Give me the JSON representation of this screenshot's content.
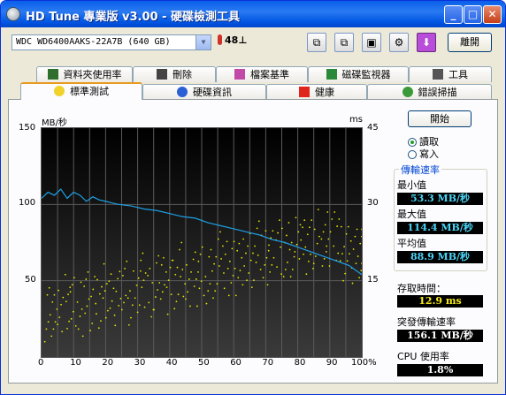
{
  "window": {
    "title": "HD Tune 專業版 v3.00 - 硬碟檢測工具",
    "min": "_",
    "max": "□",
    "close": "✕"
  },
  "toolbar": {
    "drive": "WDC WD6400AAKS-22A7B  (640 GB)",
    "temperature": "48",
    "temperature_unit": "⊥",
    "exit_label": "離開",
    "icons": [
      "copy-text-icon",
      "copy-screen-icon",
      "save-icon",
      "options-icon",
      "download-icon"
    ]
  },
  "tabs_top": [
    {
      "label": "資料夾使用率",
      "icon": "folder-usage-icon"
    },
    {
      "label": "刪除",
      "icon": "trash-icon"
    },
    {
      "label": "檔案基準",
      "icon": "file-benchmark-icon"
    },
    {
      "label": "磁碟監視器",
      "icon": "disk-monitor-icon"
    },
    {
      "label": "工具",
      "icon": "speaker-icon"
    }
  ],
  "tabs_bottom": [
    {
      "label": "標準測試",
      "icon": "bulb-icon",
      "active": true
    },
    {
      "label": "硬碟資訊",
      "icon": "info-icon"
    },
    {
      "label": "健康",
      "icon": "health-cross-icon"
    },
    {
      "label": "錯誤掃描",
      "icon": "magnifier-icon"
    }
  ],
  "benchmark": {
    "start_label": "開始",
    "read_label": "讀取",
    "write_label": "寫入",
    "transfer_group": "傳輸速率",
    "min_label": "最小值",
    "min_value": "53.3 MB/秒",
    "max_label": "最大值",
    "max_value": "114.4 MB/秒",
    "avg_label": "平均值",
    "avg_value": "88.9 MB/秒",
    "access_label": "存取時間：",
    "access_value": "12.9 ms",
    "burst_label": "突發傳輸速率",
    "burst_value": "156.1 MB/秒",
    "cpu_label": "CPU 使用率",
    "cpu_value": "1.8%"
  },
  "chart_data": {
    "type": "line",
    "ylabel": "MB/秒",
    "ylabel_right": "ms",
    "y_ticks": [
      "150",
      "100",
      "50"
    ],
    "y_right_ticks": [
      "45",
      "30",
      "15"
    ],
    "ylim": [
      0,
      150
    ],
    "ylim_right": [
      0,
      45
    ],
    "x_ticks": [
      "0",
      "10",
      "20",
      "30",
      "40",
      "50",
      "60",
      "70",
      "80",
      "90",
      "100%"
    ],
    "xlim": [
      0,
      100
    ],
    "grid": true,
    "series": [
      {
        "color": "#1ea0e6",
        "x": [
          0,
          2,
          4,
          6,
          8,
          10,
          12,
          14,
          16,
          18,
          20,
          24,
          28,
          32,
          36,
          40,
          44,
          48,
          52,
          56,
          60,
          64,
          68,
          72,
          76,
          80,
          84,
          88,
          92,
          96,
          100
        ],
        "values": [
          104,
          108,
          106,
          110,
          104,
          108,
          106,
          102,
          105,
          103,
          102,
          100,
          99,
          97,
          96,
          94,
          92,
          91,
          88,
          86,
          84,
          82,
          80,
          77,
          75,
          72,
          69,
          66,
          63,
          60,
          54
        ]
      },
      {
        "color": "#e6e600",
        "kind": "scatter",
        "note_axis": "right",
        "x": [
          2,
          4,
          6,
          8,
          10,
          12,
          14,
          16,
          18,
          20,
          22,
          24,
          26,
          28,
          30,
          32,
          34,
          36,
          38,
          40,
          42,
          44,
          46,
          48,
          50,
          52,
          54,
          56,
          58,
          60,
          62,
          64,
          66,
          68,
          70,
          72,
          74,
          76,
          78,
          80,
          82,
          84,
          86,
          88,
          90,
          92,
          94,
          96,
          98,
          100
        ],
        "values": [
          9,
          10,
          8,
          11,
          10,
          9,
          12,
          11,
          10,
          13,
          12,
          11,
          14,
          12,
          13,
          15,
          13,
          14,
          16,
          14,
          15,
          17,
          15,
          16,
          18,
          16,
          17,
          19,
          17,
          18,
          20,
          18,
          19,
          21,
          19,
          20,
          22,
          20,
          21,
          23,
          21,
          22,
          24,
          22,
          23,
          24,
          21,
          22,
          20,
          21
        ]
      }
    ]
  }
}
